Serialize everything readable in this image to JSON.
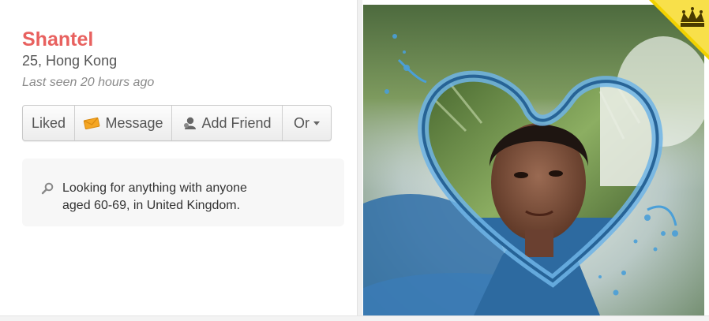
{
  "profile": {
    "name": "Shantel",
    "age_location": "25, Hong Kong",
    "last_seen": "Last seen 20 hours ago"
  },
  "actions": {
    "liked": "Liked",
    "message": "Message",
    "add_friend": "Add Friend",
    "or": "Or"
  },
  "looking_for": {
    "line1": "Looking for anything with anyone",
    "line2": "aged 60-69, in United Kingdom."
  },
  "icons": {
    "message": "envelope-icon",
    "add_friend": "person-icon",
    "looking": "magnifier-icon",
    "badge": "crown-icon"
  },
  "colors": {
    "name": "#e8615f",
    "badge": "#f2d200",
    "envelope": "#f5a623"
  }
}
